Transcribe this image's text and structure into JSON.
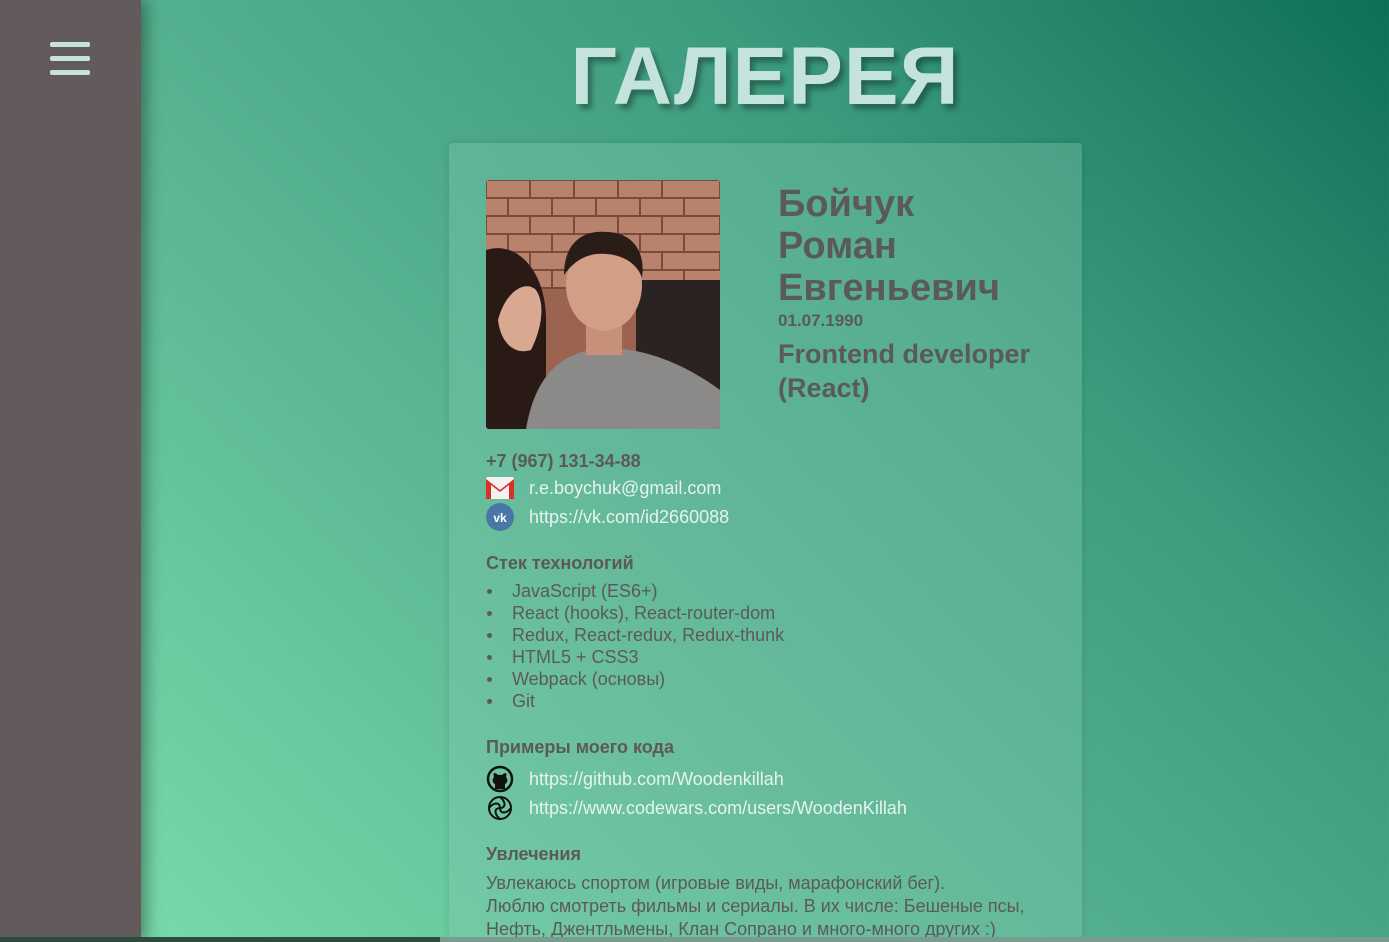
{
  "page": {
    "title": "ГАЛЕРЕЯ"
  },
  "sidebar": {
    "menu_icon": "hamburger-menu-icon"
  },
  "profile": {
    "name_lines": [
      "Бойчук",
      "Роман",
      "Евгеньевич"
    ],
    "birth_date": "01.07.1990",
    "role": "Frontend developer (React)",
    "photo_icon": "profile-photo"
  },
  "contacts": {
    "phone": "+7 (967) 131-34-88",
    "email": "r.e.boychuk@gmail.com",
    "vk": "https://vk.com/id2660088",
    "email_icon": "gmail-icon",
    "vk_icon": "vk-icon"
  },
  "stack": {
    "title": "Стек технологий",
    "items": [
      "JavaScript (ES6+)",
      "React (hooks), React-router-dom",
      "Redux, React-redux, Redux-thunk",
      "HTML5 + CSS3",
      "Webpack (основы)",
      "Git"
    ]
  },
  "code_examples": {
    "title": "Примеры моего кода",
    "github": "https://github.com/Woodenkillah",
    "codewars": "https://www.codewars.com/users/WoodenKillah",
    "github_icon": "github-icon",
    "codewars_icon": "codewars-icon"
  },
  "hobbies": {
    "title": "Увлечения",
    "lines": [
      "Увлекаюсь спортом (игровые виды, марафонский бег).",
      "Люблю смотреть фильмы и сериалы. В их числе: Бешеные псы,",
      "Нефть, Джентльмены, Клан Сопрано и много-много других :)"
    ]
  },
  "colors": {
    "sidebar": "#625a5b",
    "text_dark": "#5c5a59",
    "link": "#e6f3ee",
    "title": "#c4e3dc"
  }
}
